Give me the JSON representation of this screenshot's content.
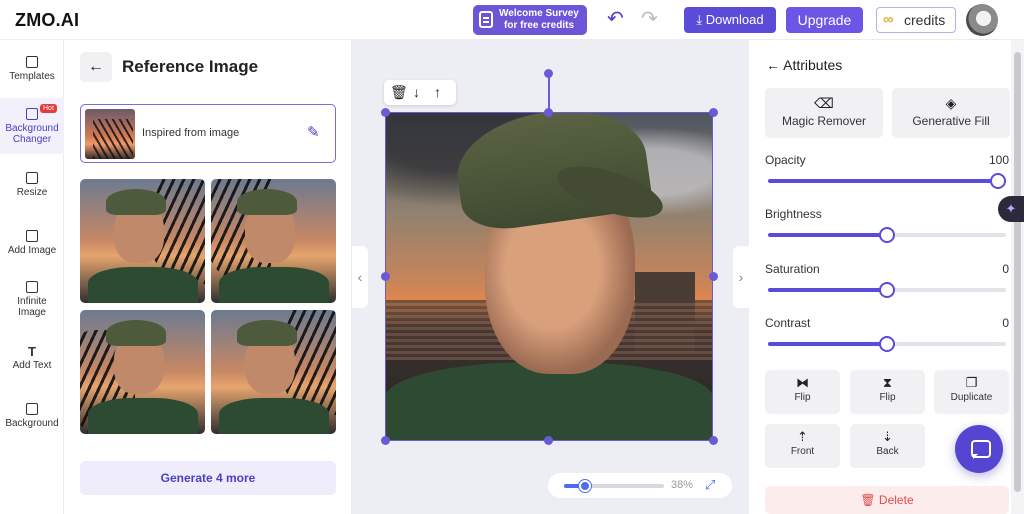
{
  "header": {
    "logo": "ZMO.AI",
    "survey_line1": "Welcome Survey",
    "survey_line2": "for free credits",
    "undo_icon": "↶",
    "redo_icon": "↷",
    "download_label": "⤓ Download",
    "upgrade_label": "Upgrade",
    "credits_icon": "∞",
    "credits_label": "credits"
  },
  "sidebar": {
    "items": [
      {
        "label": "Templates",
        "icon": "template-icon"
      },
      {
        "label_line1": "Background",
        "label_line2": "Changer",
        "badge": "Hot",
        "icon": "layers-icon"
      },
      {
        "label": "Resize",
        "icon": "crop-icon"
      },
      {
        "label": "Add Image",
        "icon": "image-icon"
      },
      {
        "label_line1": "Infinite",
        "label_line2": "Image",
        "icon": "expand-icon"
      },
      {
        "label": "Add Text",
        "icon": "text-icon",
        "glyph": "T"
      },
      {
        "label": "Background",
        "icon": "image-icon"
      }
    ]
  },
  "reference": {
    "back_icon": "←",
    "title": "Reference Image",
    "card_label": "Inspired from image",
    "edit_icon": "✎",
    "generate_label": "Generate 4 more"
  },
  "canvas": {
    "toolbar_delete": "🗑",
    "toolbar_down": "↓",
    "toolbar_up": "↑",
    "nav_prev": "‹",
    "nav_next": "›",
    "zoom_percent": 38,
    "zoom_label": "38%",
    "fit_icon": "⤢"
  },
  "attributes": {
    "back_icon": "←",
    "title": "Attributes",
    "magic_remover_label": "Magic Remover",
    "magic_remover_icon": "⌫",
    "generative_fill_label": "Generative Fill",
    "generative_fill_icon": "◈",
    "sliders": [
      {
        "label": "Opacity",
        "value": "100",
        "fraction": 1.0
      },
      {
        "label": "Brightness",
        "value": "",
        "fraction": 0.5
      },
      {
        "label": "Saturation",
        "value": "0",
        "fraction": 0.5
      },
      {
        "label": "Contrast",
        "value": "0",
        "fraction": 0.5
      }
    ],
    "actions": [
      {
        "label": "Flip",
        "icon": "⧓"
      },
      {
        "label": "Flip",
        "icon": "⧗"
      },
      {
        "label": "Duplicate",
        "icon": "❐"
      },
      {
        "label": "Front",
        "icon": "⇡"
      },
      {
        "label": "Back",
        "icon": "⇣"
      }
    ],
    "delete_label": "🗑 Delete"
  },
  "floating": {
    "sparkle_icon": "✦"
  },
  "colors": {
    "accent": "#5b4bd9",
    "delete": "#e34a4a"
  }
}
